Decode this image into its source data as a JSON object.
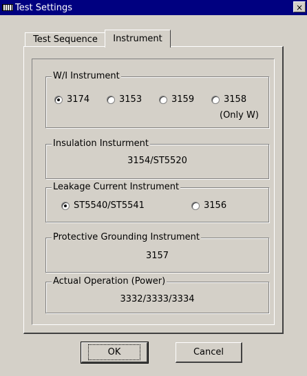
{
  "window": {
    "title": "Test Settings",
    "close_glyph": "×",
    "app_icon": "keyboard-icon"
  },
  "tabs": [
    {
      "label": "Test Sequence",
      "active": false
    },
    {
      "label": "Instrument",
      "active": true
    }
  ],
  "groups": {
    "wi": {
      "label": "W/I Instrument",
      "options": [
        {
          "label": "3174",
          "checked": true
        },
        {
          "label": "3153",
          "checked": false
        },
        {
          "label": "3159",
          "checked": false
        },
        {
          "label": "3158",
          "checked": false
        }
      ],
      "note": "(Only W)"
    },
    "insulation": {
      "label": "Insulation Insturment",
      "value": "3154/ST5520"
    },
    "leakage": {
      "label": "Leakage Current Instrument",
      "options": [
        {
          "label": "ST5540/ST5541",
          "checked": true
        },
        {
          "label": "3156",
          "checked": false
        }
      ]
    },
    "grounding": {
      "label": "Protective Grounding Instrument",
      "value": "3157"
    },
    "actual": {
      "label": "Actual Operation (Power)",
      "value": "3332/3333/3334"
    }
  },
  "buttons": {
    "ok": "OK",
    "cancel": "Cancel"
  }
}
